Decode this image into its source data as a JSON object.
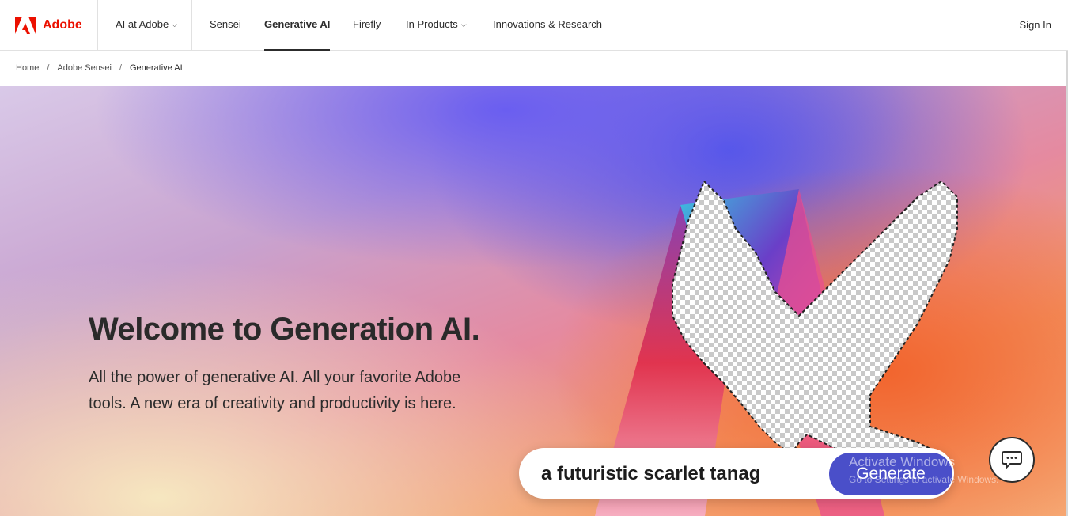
{
  "nav": {
    "brand": "Adobe",
    "items": [
      {
        "label": "AI at Adobe",
        "dropdown": true
      },
      {
        "label": "Sensei",
        "dropdown": false
      },
      {
        "label": "Generative AI",
        "dropdown": false,
        "active": true
      },
      {
        "label": "Firefly",
        "dropdown": false
      },
      {
        "label": "In Products",
        "dropdown": true
      },
      {
        "label": "Innovations & Research",
        "dropdown": false
      }
    ],
    "sign_in": "Sign In",
    "chevron": "⌵"
  },
  "breadcrumb": {
    "items": [
      "Home",
      "Adobe Sensei",
      "Generative AI"
    ],
    "separator": "/"
  },
  "hero": {
    "title": "Welcome to Generation AI.",
    "subtitle": "All the power of generative AI. All your favorite Adobe tools. A new era of creativity and productivity is here.",
    "prompt_value": "a futuristic scarlet tanag",
    "generate_label": "Generate"
  },
  "overlay": {
    "activate_title": "Activate Windows",
    "activate_sub": "Go to Settings to activate Windows."
  },
  "colors": {
    "brand_red": "#eb1000",
    "generate_bg": "#4a4fc9"
  },
  "icons": {
    "logo": "adobe-logo-icon",
    "chat": "chat-bubble-icon"
  }
}
